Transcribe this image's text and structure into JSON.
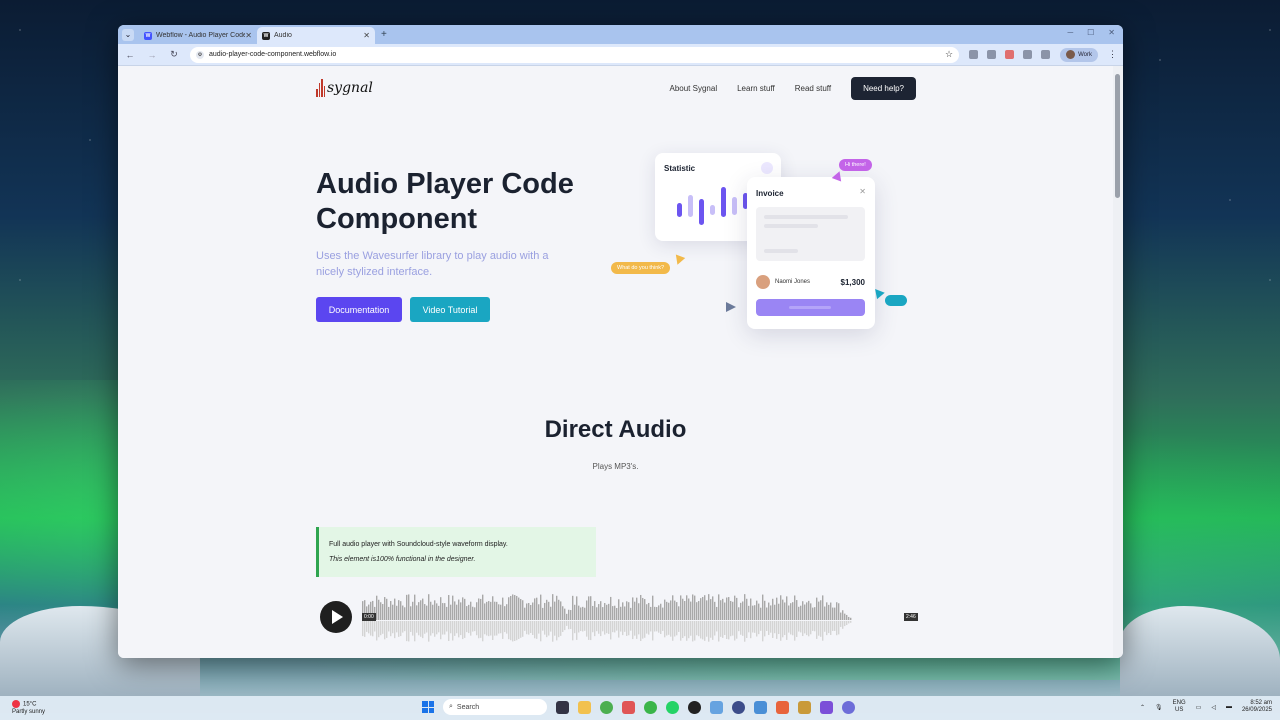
{
  "browser": {
    "tabs": [
      {
        "label": "Webflow - Audio Player Code C",
        "active": false
      },
      {
        "label": "Audio",
        "active": true
      }
    ],
    "url": "audio-player-code-component.webflow.io",
    "profile_label": "Work"
  },
  "site": {
    "logo_text": "sygnal",
    "nav": [
      "About Sygnal",
      "Learn stuff",
      "Read stuff"
    ],
    "cta": "Need help?"
  },
  "hero": {
    "title": "Audio Player Code Component",
    "subtitle": "Uses the Wavesurfer library to play audio with a nicely stylized interface.",
    "buttons": {
      "docs": "Documentation",
      "video": "Video Tutorial"
    },
    "accent_colors": {
      "primary": "#5b46f0",
      "secondary": "#1aa6c2"
    }
  },
  "illustration": {
    "statistic_title": "Statistic",
    "invoice_title": "Invoice",
    "person_name": "Naomi Jones",
    "amount": "$1,300",
    "bubble_hi": "Hi there!",
    "bubble_what": "What do you think?"
  },
  "section": {
    "title": "Direct Audio",
    "subtitle": "Plays MP3's.",
    "note_line1": "Full audio player with Soundcloud-style waveform display.",
    "note_line2": "This element is100% functional in the designer."
  },
  "player": {
    "current_time": "0:00",
    "duration": "2:46",
    "progress": 0
  },
  "taskbar": {
    "weather_temp": "15°C",
    "weather_desc": "Partly sunny",
    "search_placeholder": "Search",
    "lang_line1": "ENG",
    "lang_line2": "US",
    "time": "8:52 am",
    "date": "26/09/2025"
  }
}
